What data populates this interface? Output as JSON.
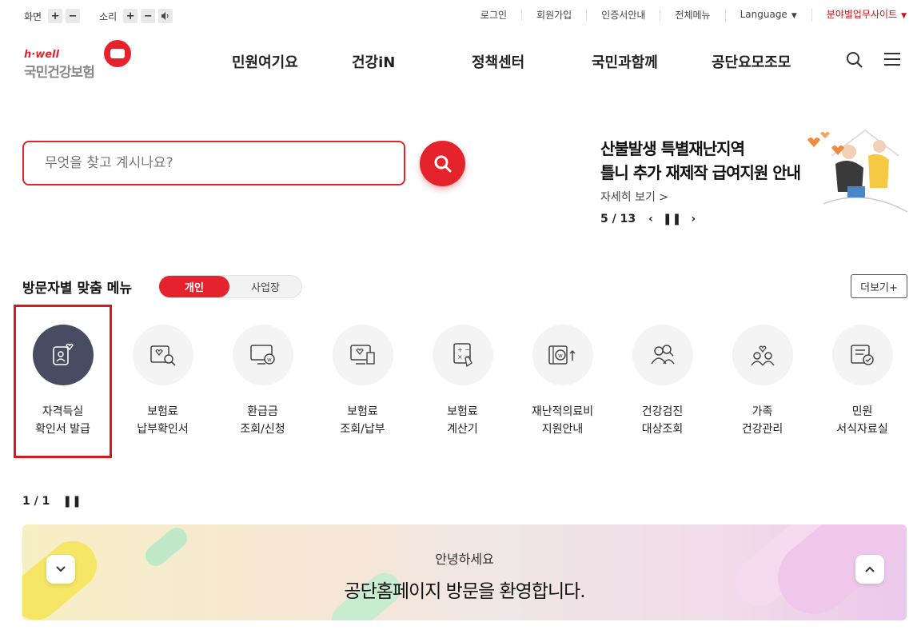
{
  "util": {
    "screen_label": "화면",
    "sound_label": "소리",
    "plus": "+",
    "minus": "−",
    "links": [
      "로그인",
      "회원가입",
      "인증서안내",
      "전체메뉴",
      "Language"
    ],
    "field_site": "분야별업무사이트"
  },
  "logo": {
    "en": "h·well",
    "kr": "국민건강보험"
  },
  "gnb": [
    "민원여기요",
    "건강iN",
    "정책센터",
    "국민과함께",
    "공단요모조모"
  ],
  "search": {
    "placeholder": "무엇을 찾고 계시나요?"
  },
  "banner": {
    "title_line1": "산불발생 특별재난지역",
    "title_line2": "틀니 추가 재제작 급여지원 안내",
    "more": "자세히 보기",
    "page": "5 / 13"
  },
  "visitor_menu": {
    "title": "방문자별 맞춤 메뉴",
    "tab_personal": "개인",
    "tab_business": "사업장",
    "more": "더보기+",
    "items": [
      {
        "line1": "자격득실",
        "line2": "확인서 발급",
        "icon": "id-heart-icon"
      },
      {
        "line1": "보험료",
        "line2": "납부확인서",
        "icon": "doc-search-icon"
      },
      {
        "line1": "환급금",
        "line2": "조회/신청",
        "icon": "monitor-won-icon"
      },
      {
        "line1": "보험료",
        "line2": "조회/납부",
        "icon": "monitor-receipt-icon"
      },
      {
        "line1": "보험료",
        "line2": "계산기",
        "icon": "calculator-icon"
      },
      {
        "line1": "재난적의료비",
        "line2": "지원안내",
        "icon": "won-arrow-icon"
      },
      {
        "line1": "건강검진",
        "line2": "대상조회",
        "icon": "people-search-icon"
      },
      {
        "line1": "가족",
        "line2": "건강관리",
        "icon": "family-heart-icon"
      },
      {
        "line1": "민원",
        "line2": "서식자료실",
        "icon": "form-check-icon"
      }
    ],
    "page": "1 / 1"
  },
  "welcome": {
    "greeting": "안녕하세요",
    "message": "공단홈페이지 방문을 환영합니다."
  },
  "colors": {
    "brand_red": "#e4232c",
    "active_icon_bg": "#484c62"
  }
}
